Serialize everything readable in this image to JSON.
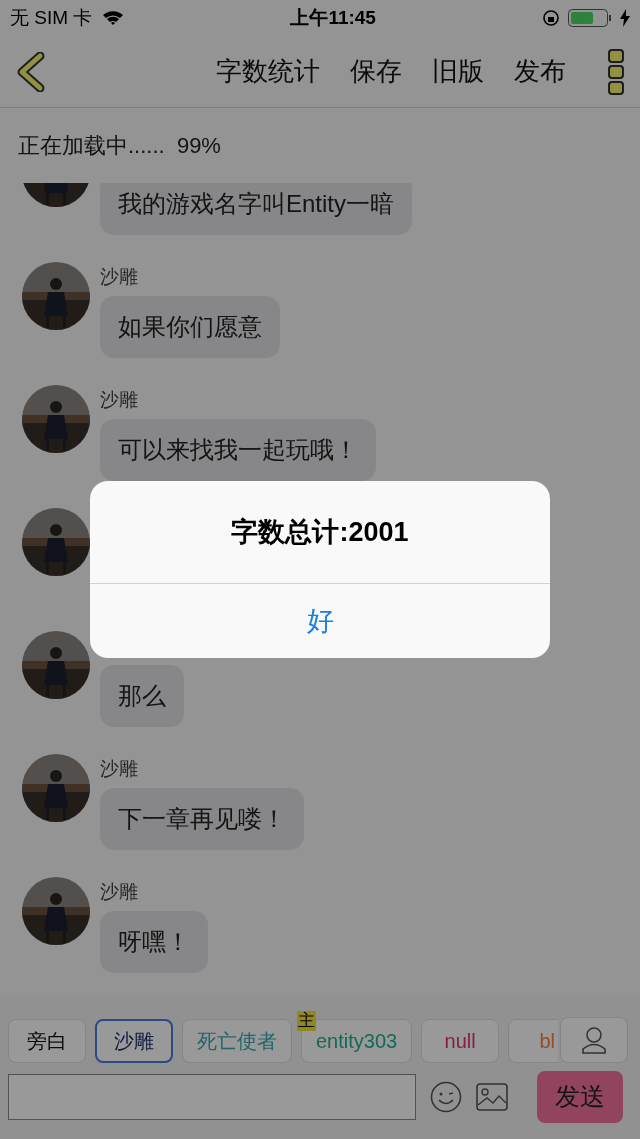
{
  "status_bar": {
    "carrier": "无 SIM 卡",
    "time": "上午11:45"
  },
  "nav": {
    "actions": [
      "字数统计",
      "保存",
      "旧版",
      "发布"
    ]
  },
  "loading": {
    "text": "正在加载中......  99%"
  },
  "messages": [
    {
      "kind": "text",
      "text": "我的游戏名字叫Entity一暗"
    },
    {
      "kind": "text",
      "name": "沙雕",
      "text": "如果你们愿意"
    },
    {
      "kind": "text",
      "name": "沙雕",
      "text": "可以来找我一起玩哦！"
    },
    {
      "kind": "hidden"
    },
    {
      "kind": "text",
      "text": "那么"
    },
    {
      "kind": "text",
      "name": "沙雕",
      "text": "下一章再见喽！"
    },
    {
      "kind": "text",
      "name": "沙雕",
      "text": "呀嘿！"
    }
  ],
  "roles": [
    {
      "label": "旁白",
      "selected": false,
      "color": "#0a0a0a"
    },
    {
      "label": "沙雕",
      "selected": true,
      "color": "#101940"
    },
    {
      "label": "死亡使者",
      "selected": false,
      "color": "#23656a"
    },
    {
      "label": "entity303",
      "selected": false,
      "color": "#136a56",
      "badge": "主"
    },
    {
      "label": "null",
      "selected": false,
      "color": "#861d49"
    },
    {
      "label": "bl",
      "selected": false,
      "color": "#904d26"
    }
  ],
  "composer": {
    "send": "发送"
  },
  "dialog": {
    "title": "字数总计:2001",
    "button": "好"
  }
}
